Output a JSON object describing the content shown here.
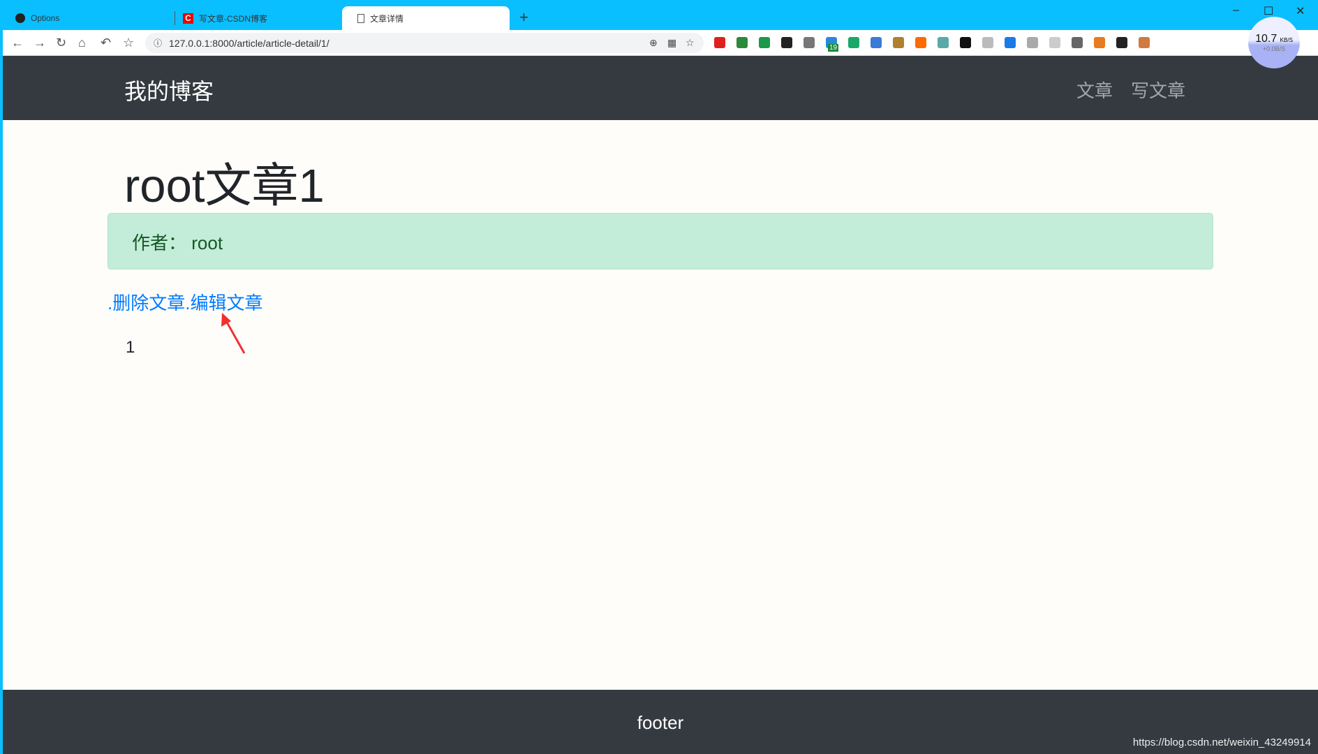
{
  "browser": {
    "tabs": [
      {
        "label": "Options",
        "icon": "github-icon"
      },
      {
        "label": "写文章-CSDN博客",
        "icon": "csdn-icon"
      },
      {
        "label": "文章详情",
        "icon": "page-icon",
        "active": true
      }
    ],
    "url": "127.0.0.1:8000/article/article-detail/1/",
    "extension_badge": "19",
    "net_speed": {
      "down": "10.7",
      "unit": "KB/S",
      "up": "+0.0B/S"
    },
    "extension_colors": [
      "#e02020",
      "#2a8a3a",
      "#1a9a4a",
      "#222222",
      "#777777",
      "#2a8ad8",
      "#1aa86a",
      "#3a7ad8",
      "#b08030",
      "#ff6a00",
      "#5aa8a8",
      "#111111",
      "#bbbbbb",
      "#1a7ae8",
      "#aaaaaa",
      "#cccccc",
      "#666666",
      "#e87a20",
      "#222222",
      "#d07a40"
    ]
  },
  "navbar": {
    "brand": "我的博客",
    "links": [
      "文章",
      "写文章"
    ]
  },
  "article": {
    "title": "root文章1",
    "author_label": "作者：",
    "author": "root",
    "delete_link": ".删除文章",
    "edit_link": ".编辑文章",
    "body": "1"
  },
  "footer": {
    "text": "footer"
  },
  "watermark": "https://blog.csdn.net/weixin_43249914"
}
